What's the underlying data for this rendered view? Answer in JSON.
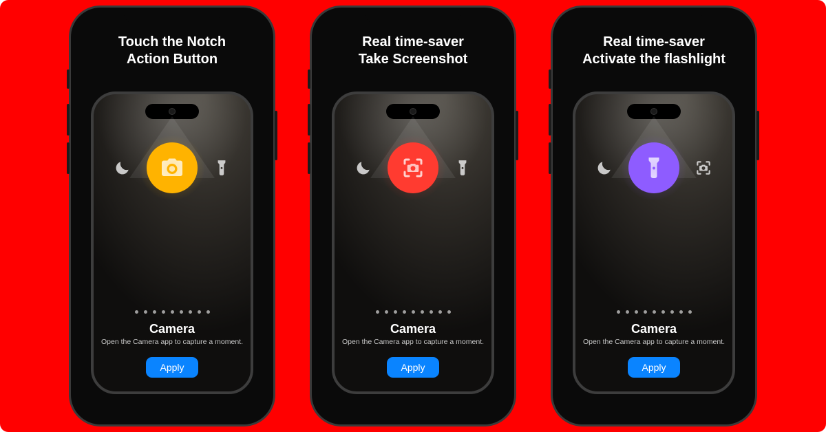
{
  "colors": {
    "accent_amber": "#ffb300",
    "accent_red": "#ff3b30",
    "accent_violet": "#8e5cff",
    "apply_blue": "#0a84ff",
    "stage_bg": "#ff0000"
  },
  "common": {
    "feature_title": "Camera",
    "feature_sub": "Open the Camera app to capture a moment.",
    "apply_label": "Apply",
    "page_dot_count": 9
  },
  "panels": [
    {
      "heading": "Touch the Notch\nAction Button",
      "center_icon": "camera-icon",
      "center_color": "#ffb300",
      "left_icon": "moon-icon",
      "right_icon": "flashlight-icon"
    },
    {
      "heading": "Real time-saver\nTake Screenshot",
      "center_icon": "screenshot-icon",
      "center_color": "#ff3b30",
      "left_icon": "moon-icon",
      "right_icon": "flashlight-icon"
    },
    {
      "heading": "Real time-saver\nActivate the flashlight",
      "center_icon": "flashlight-icon",
      "center_color": "#8e5cff",
      "left_icon": "moon-icon",
      "right_icon": "screenshot-icon"
    }
  ]
}
